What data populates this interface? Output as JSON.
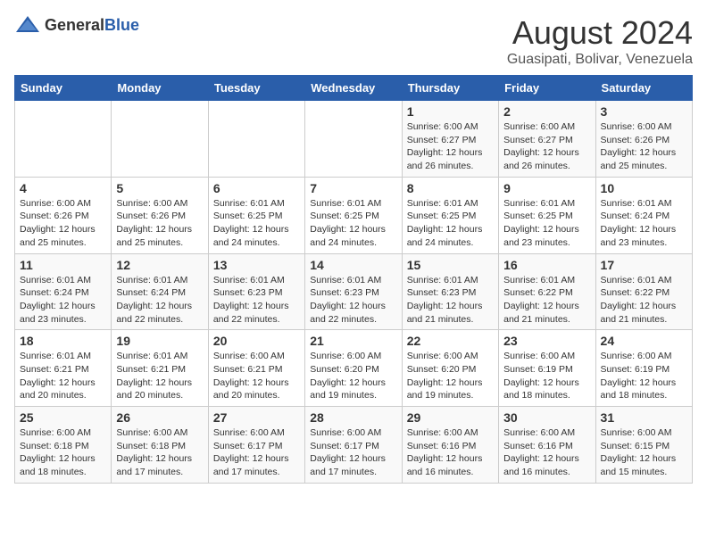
{
  "header": {
    "logo_general": "General",
    "logo_blue": "Blue",
    "month_title": "August 2024",
    "location": "Guasipati, Bolivar, Venezuela"
  },
  "days_of_week": [
    "Sunday",
    "Monday",
    "Tuesday",
    "Wednesday",
    "Thursday",
    "Friday",
    "Saturday"
  ],
  "weeks": [
    [
      {
        "day": "",
        "info": ""
      },
      {
        "day": "",
        "info": ""
      },
      {
        "day": "",
        "info": ""
      },
      {
        "day": "",
        "info": ""
      },
      {
        "day": "1",
        "info": "Sunrise: 6:00 AM\nSunset: 6:27 PM\nDaylight: 12 hours\nand 26 minutes."
      },
      {
        "day": "2",
        "info": "Sunrise: 6:00 AM\nSunset: 6:27 PM\nDaylight: 12 hours\nand 26 minutes."
      },
      {
        "day": "3",
        "info": "Sunrise: 6:00 AM\nSunset: 6:26 PM\nDaylight: 12 hours\nand 25 minutes."
      }
    ],
    [
      {
        "day": "4",
        "info": "Sunrise: 6:00 AM\nSunset: 6:26 PM\nDaylight: 12 hours\nand 25 minutes."
      },
      {
        "day": "5",
        "info": "Sunrise: 6:00 AM\nSunset: 6:26 PM\nDaylight: 12 hours\nand 25 minutes."
      },
      {
        "day": "6",
        "info": "Sunrise: 6:01 AM\nSunset: 6:25 PM\nDaylight: 12 hours\nand 24 minutes."
      },
      {
        "day": "7",
        "info": "Sunrise: 6:01 AM\nSunset: 6:25 PM\nDaylight: 12 hours\nand 24 minutes."
      },
      {
        "day": "8",
        "info": "Sunrise: 6:01 AM\nSunset: 6:25 PM\nDaylight: 12 hours\nand 24 minutes."
      },
      {
        "day": "9",
        "info": "Sunrise: 6:01 AM\nSunset: 6:25 PM\nDaylight: 12 hours\nand 23 minutes."
      },
      {
        "day": "10",
        "info": "Sunrise: 6:01 AM\nSunset: 6:24 PM\nDaylight: 12 hours\nand 23 minutes."
      }
    ],
    [
      {
        "day": "11",
        "info": "Sunrise: 6:01 AM\nSunset: 6:24 PM\nDaylight: 12 hours\nand 23 minutes."
      },
      {
        "day": "12",
        "info": "Sunrise: 6:01 AM\nSunset: 6:24 PM\nDaylight: 12 hours\nand 22 minutes."
      },
      {
        "day": "13",
        "info": "Sunrise: 6:01 AM\nSunset: 6:23 PM\nDaylight: 12 hours\nand 22 minutes."
      },
      {
        "day": "14",
        "info": "Sunrise: 6:01 AM\nSunset: 6:23 PM\nDaylight: 12 hours\nand 22 minutes."
      },
      {
        "day": "15",
        "info": "Sunrise: 6:01 AM\nSunset: 6:23 PM\nDaylight: 12 hours\nand 21 minutes."
      },
      {
        "day": "16",
        "info": "Sunrise: 6:01 AM\nSunset: 6:22 PM\nDaylight: 12 hours\nand 21 minutes."
      },
      {
        "day": "17",
        "info": "Sunrise: 6:01 AM\nSunset: 6:22 PM\nDaylight: 12 hours\nand 21 minutes."
      }
    ],
    [
      {
        "day": "18",
        "info": "Sunrise: 6:01 AM\nSunset: 6:21 PM\nDaylight: 12 hours\nand 20 minutes."
      },
      {
        "day": "19",
        "info": "Sunrise: 6:01 AM\nSunset: 6:21 PM\nDaylight: 12 hours\nand 20 minutes."
      },
      {
        "day": "20",
        "info": "Sunrise: 6:00 AM\nSunset: 6:21 PM\nDaylight: 12 hours\nand 20 minutes."
      },
      {
        "day": "21",
        "info": "Sunrise: 6:00 AM\nSunset: 6:20 PM\nDaylight: 12 hours\nand 19 minutes."
      },
      {
        "day": "22",
        "info": "Sunrise: 6:00 AM\nSunset: 6:20 PM\nDaylight: 12 hours\nand 19 minutes."
      },
      {
        "day": "23",
        "info": "Sunrise: 6:00 AM\nSunset: 6:19 PM\nDaylight: 12 hours\nand 18 minutes."
      },
      {
        "day": "24",
        "info": "Sunrise: 6:00 AM\nSunset: 6:19 PM\nDaylight: 12 hours\nand 18 minutes."
      }
    ],
    [
      {
        "day": "25",
        "info": "Sunrise: 6:00 AM\nSunset: 6:18 PM\nDaylight: 12 hours\nand 18 minutes."
      },
      {
        "day": "26",
        "info": "Sunrise: 6:00 AM\nSunset: 6:18 PM\nDaylight: 12 hours\nand 17 minutes."
      },
      {
        "day": "27",
        "info": "Sunrise: 6:00 AM\nSunset: 6:17 PM\nDaylight: 12 hours\nand 17 minutes."
      },
      {
        "day": "28",
        "info": "Sunrise: 6:00 AM\nSunset: 6:17 PM\nDaylight: 12 hours\nand 17 minutes."
      },
      {
        "day": "29",
        "info": "Sunrise: 6:00 AM\nSunset: 6:16 PM\nDaylight: 12 hours\nand 16 minutes."
      },
      {
        "day": "30",
        "info": "Sunrise: 6:00 AM\nSunset: 6:16 PM\nDaylight: 12 hours\nand 16 minutes."
      },
      {
        "day": "31",
        "info": "Sunrise: 6:00 AM\nSunset: 6:15 PM\nDaylight: 12 hours\nand 15 minutes."
      }
    ]
  ]
}
